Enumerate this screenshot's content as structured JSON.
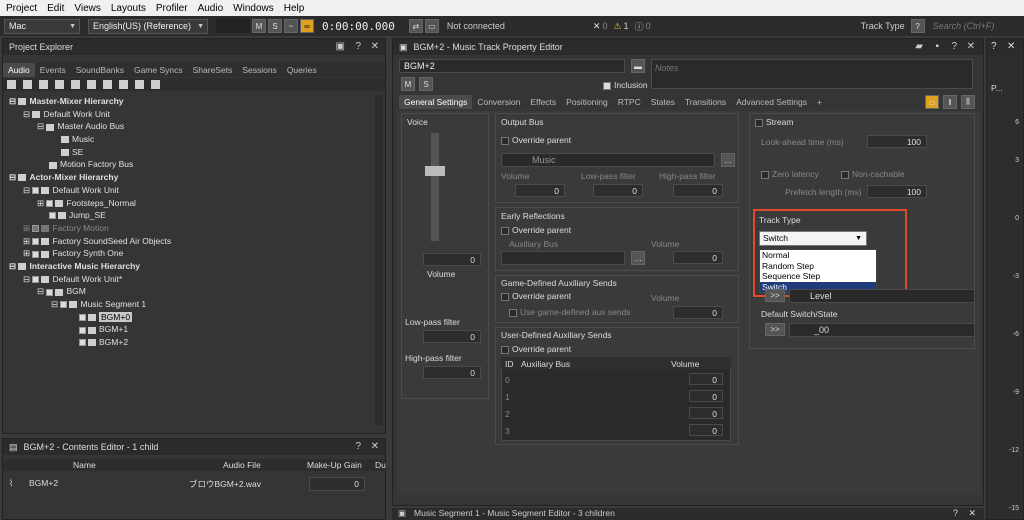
{
  "menu": [
    "Project",
    "Edit",
    "Views",
    "Layouts",
    "Profiler",
    "Audio",
    "Windows",
    "Help"
  ],
  "toolbar": {
    "platform": "Mac",
    "language": "English(US) (Reference)",
    "m": "M",
    "s": "S",
    "time": "0:00:00.000",
    "connection": "Not connected",
    "err_count": "0",
    "warn_count": "1",
    "info_count": "0",
    "track_type_label": "Track Type",
    "help": "?",
    "search_placeholder": "Search (Ctrl+F)"
  },
  "explorer": {
    "title": "Project Explorer",
    "tabs": [
      "Audio",
      "Events",
      "SoundBanks",
      "Game Syncs",
      "ShareSets",
      "Sessions",
      "Queries"
    ],
    "tree": [
      "Master-Mixer Hierarchy",
      "Default Work Unit",
      "Master Audio Bus",
      "Music",
      "SE",
      "Motion Factory Bus",
      "Actor-Mixer Hierarchy",
      "Default Work Unit",
      "Footsteps_Normal",
      "Jump_SE",
      "Factory Motion",
      "Factory SoundSeed Air Objects",
      "Factory Synth One",
      "Interactive Music Hierarchy",
      "Default Work Unit*",
      "BGM",
      "Music Segment 1",
      "BGM+0",
      "BGM+1",
      "BGM+2"
    ]
  },
  "contents": {
    "title": "BGM+2 - Contents Editor - 1 child",
    "cols": [
      "Name",
      "Audio File",
      "Make-Up Gain",
      "Du"
    ],
    "row_name": "BGM+2",
    "row_file": "ブロウBGM+2.wav",
    "row_gain": "0"
  },
  "editor": {
    "title": "BGM+2 - Music Track Property Editor",
    "name": "BGM+2",
    "notes": "Notes",
    "inclusion": "Inclusion",
    "m": "M",
    "s": "S",
    "tabs": [
      "General Settings",
      "Conversion",
      "Effects",
      "Positioning",
      "RTPC",
      "States",
      "Transitions",
      "Advanced Settings",
      "+"
    ],
    "voice": "Voice",
    "volume_val": "0",
    "volume": "Volume",
    "lpf": "Low-pass filter",
    "lpf_val": "0",
    "hpf": "High-pass filter",
    "hpf_val": "0",
    "output_bus": "Output Bus",
    "override_parent": "Override parent",
    "music_bus": "Music",
    "col_volume": "Volume",
    "col_lpf": "Low-pass filter",
    "col_hpf": "High-pass filter",
    "zero": "0",
    "early_ref": "Early Reflections",
    "aux_bus": "Auxiliary Bus",
    "volume2": "Volume",
    "game_aux": "Game-Defined Auxiliary Sends",
    "use_game_aux": "Use game-defined aux sends",
    "user_aux": "User-Defined Auxiliary Sends",
    "aux_cols": [
      "ID",
      "Auxiliary Bus",
      "Volume"
    ],
    "aux_ids": [
      "0",
      "1",
      "2",
      "3"
    ],
    "stream": "Stream",
    "lookahead": "Look-ahead time (ms)",
    "lookahead_val": "100",
    "zero_latency": "Zero latency",
    "non_cachable": "Non-cachable",
    "prefetch": "Prefetch length (ms)",
    "prefetch_val": "100",
    "track_type": "Track Type",
    "track_type_val": "Switch",
    "options": [
      "Normal",
      "Random Step",
      "Sequence Step",
      "Switch"
    ],
    "arrow_btn": ">>",
    "level": "Level",
    "default_switch": "Default Switch/State",
    "default_val": "_00"
  },
  "segment_title": "Music Segment 1 - Music Segment Editor - 3 children",
  "meter": {
    "label": "P...",
    "ticks": [
      "6",
      "3",
      "0",
      "-3",
      "-6",
      "-9",
      "-12",
      "-15"
    ]
  },
  "colors": {
    "highlight": "#e24a2b",
    "selection": "#1f3b7a"
  }
}
